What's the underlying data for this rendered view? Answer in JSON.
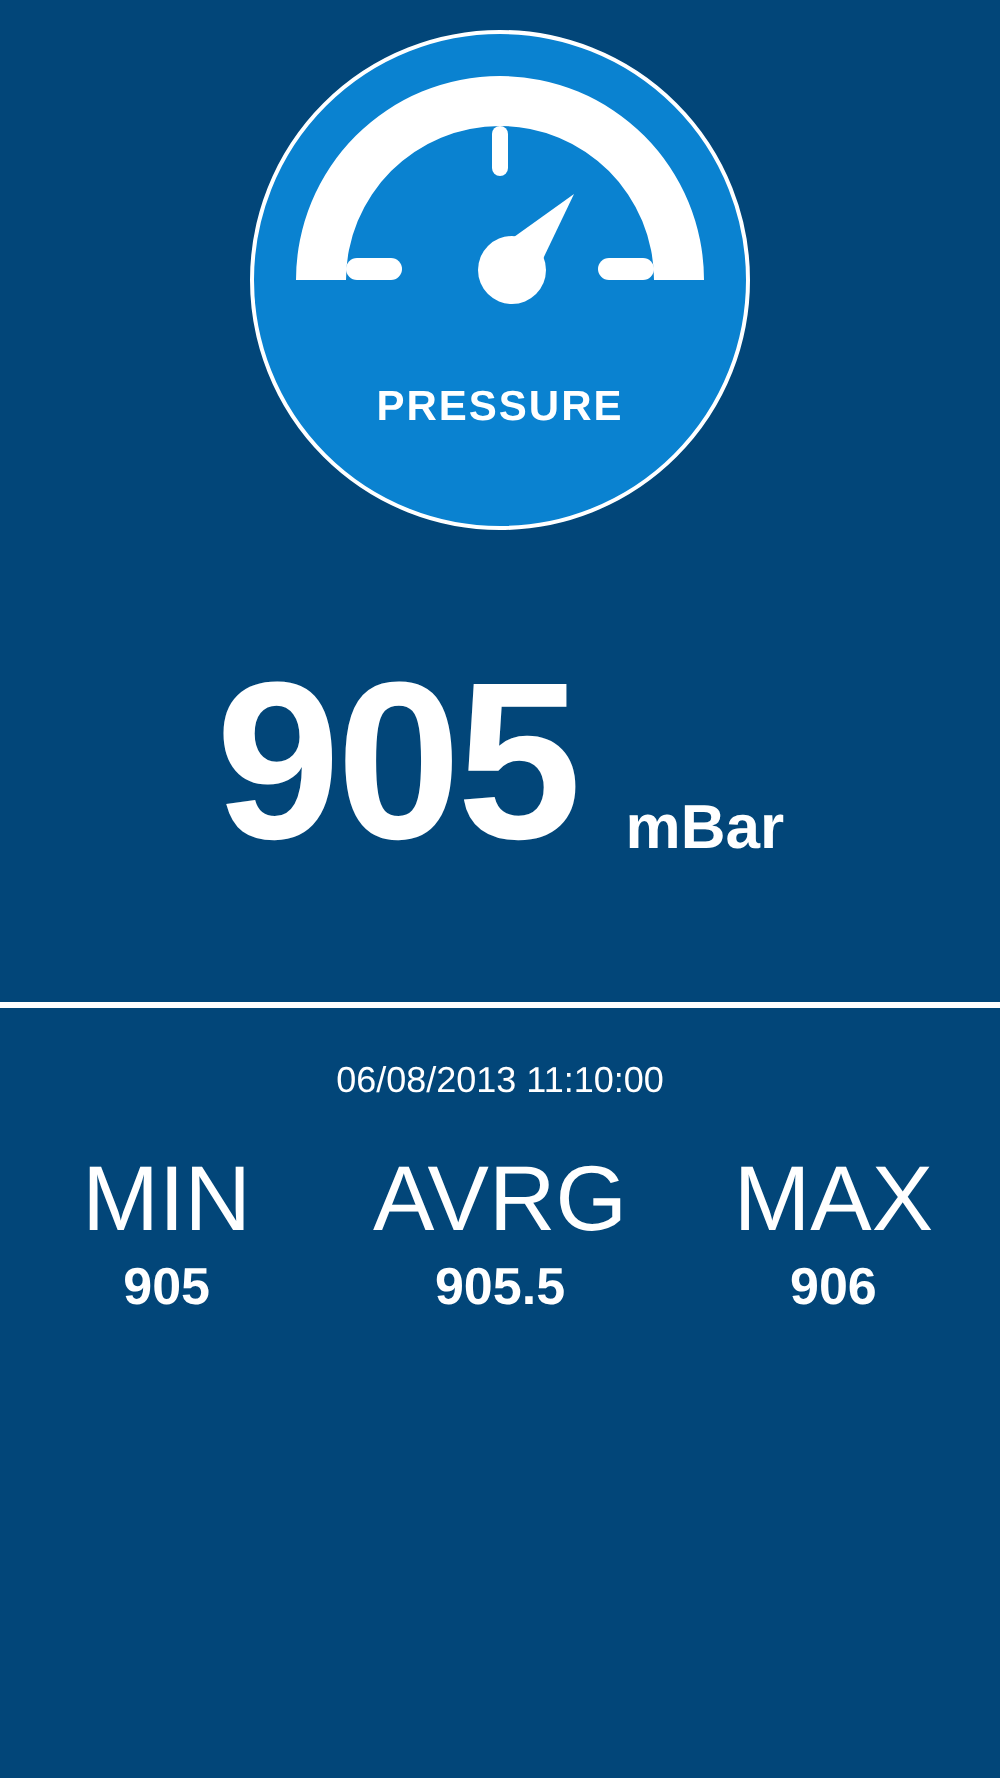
{
  "emblem": {
    "label": "PRESSURE"
  },
  "reading": {
    "value": "905",
    "unit": "mBar"
  },
  "timestamp": "06/08/2013 11:10:00",
  "stats": [
    {
      "label": "MIN",
      "value": "905"
    },
    {
      "label": "AVRG",
      "value": "905.5"
    },
    {
      "label": "MAX",
      "value": "906"
    }
  ]
}
